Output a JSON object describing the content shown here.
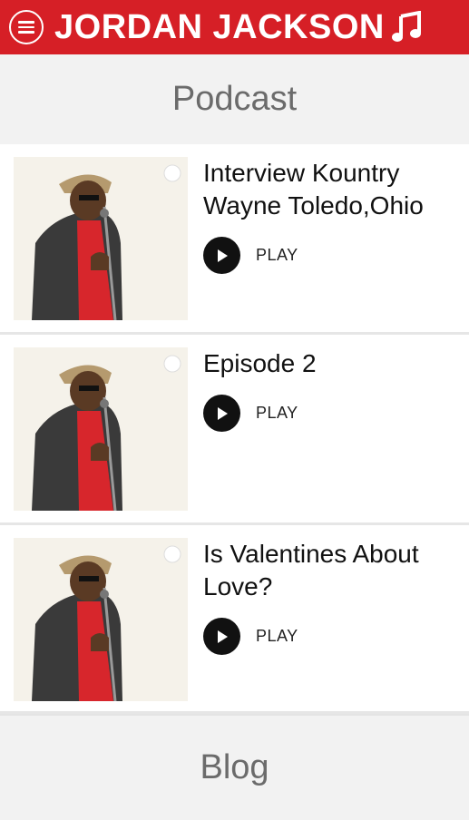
{
  "header": {
    "title": "JORDAN JACKSON",
    "menu_icon": "menu-icon",
    "music_icon": "music-note-icon",
    "brand_color": "#d61f26"
  },
  "section": {
    "title": "Podcast"
  },
  "episodes": [
    {
      "title": "Interview Kountry Wayne Toledo,Ohio",
      "play_label": "PLAY",
      "thumbnail": "artist-photo"
    },
    {
      "title": "Episode 2",
      "play_label": "PLAY",
      "thumbnail": "artist-photo"
    },
    {
      "title": "Is Valentines About Love?",
      "play_label": "PLAY",
      "thumbnail": "artist-photo"
    }
  ],
  "footer": {
    "title": "Blog"
  }
}
